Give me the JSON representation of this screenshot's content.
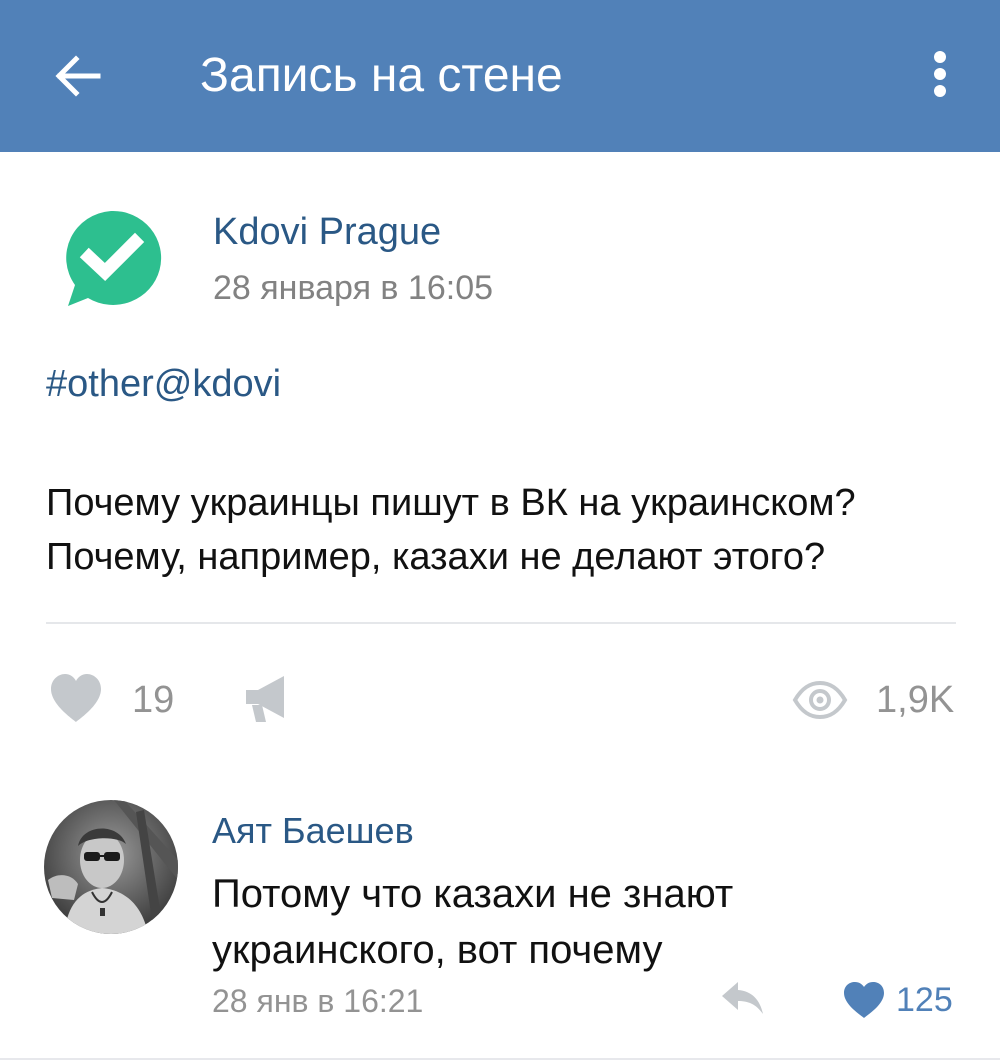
{
  "topbar": {
    "title": "Запись на стене",
    "back_icon": "arrow-left-icon",
    "menu_icon": "more-vertical-icon",
    "color": "#5181b8"
  },
  "post": {
    "author": "Kdovi Prague",
    "date": "28 января в 16:05",
    "avatar_icon": "checkmark-speech-bubble-icon",
    "avatar_color": "#2dbf8f",
    "hashtag": "#other@kdovi",
    "text_lines": [
      "Почему украинцы пишут в ВК на украинском?",
      "Почему, например, казахи не делают этого?"
    ],
    "likes": "19",
    "views": "1,9K",
    "like_icon": "heart-icon",
    "share_icon": "megaphone-icon",
    "views_icon": "eye-icon"
  },
  "comment": {
    "author": "Аят Баешев",
    "text_lines": [
      "Потому что казахи не знают",
      "украинского, вот почему"
    ],
    "date": "28 янв в 16:21",
    "likes": "125",
    "reply_icon": "reply-arrow-icon",
    "like_icon": "heart-filled-icon"
  },
  "colors": {
    "link": "#2a5885",
    "secondary": "#939393",
    "accent": "#5181b8"
  }
}
